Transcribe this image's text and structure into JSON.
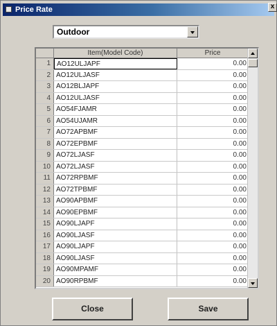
{
  "window": {
    "title": "Price Rate",
    "close_glyph": "x"
  },
  "filter": {
    "selected": "Outdoor"
  },
  "grid": {
    "headers": {
      "item": "Item(Model Code)",
      "price": "Price"
    },
    "rows": [
      {
        "num": "1",
        "item": "AO12ULJAPF",
        "price": "0.00"
      },
      {
        "num": "2",
        "item": "AO12ULJASF",
        "price": "0.00"
      },
      {
        "num": "3",
        "item": "AO12BLJAPF",
        "price": "0.00"
      },
      {
        "num": "4",
        "item": "AO12ULJASF",
        "price": "0.00"
      },
      {
        "num": "5",
        "item": "AO54FJAMR",
        "price": "0.00"
      },
      {
        "num": "6",
        "item": "AO54UJAMR",
        "price": "0.00"
      },
      {
        "num": "7",
        "item": "AO72APBMF",
        "price": "0.00"
      },
      {
        "num": "8",
        "item": "AO72EPBMF",
        "price": "0.00"
      },
      {
        "num": "9",
        "item": "AO72LJASF",
        "price": "0.00"
      },
      {
        "num": "10",
        "item": "AO72LJASF",
        "price": "0.00"
      },
      {
        "num": "11",
        "item": "AO72RPBMF",
        "price": "0.00"
      },
      {
        "num": "12",
        "item": "AO72TPBMF",
        "price": "0.00"
      },
      {
        "num": "13",
        "item": "AO90APBMF",
        "price": "0.00"
      },
      {
        "num": "14",
        "item": "AO90EPBMF",
        "price": "0.00"
      },
      {
        "num": "15",
        "item": "AO90LJAPF",
        "price": "0.00"
      },
      {
        "num": "16",
        "item": "AO90LJASF",
        "price": "0.00"
      },
      {
        "num": "17",
        "item": "AO90LJAPF",
        "price": "0.00"
      },
      {
        "num": "18",
        "item": "AO90LJASF",
        "price": "0.00"
      },
      {
        "num": "19",
        "item": "AO90MPAMF",
        "price": "0.00"
      },
      {
        "num": "20",
        "item": "AO90RPBMF",
        "price": "0.00"
      }
    ]
  },
  "buttons": {
    "close": "Close",
    "save": "Save"
  }
}
